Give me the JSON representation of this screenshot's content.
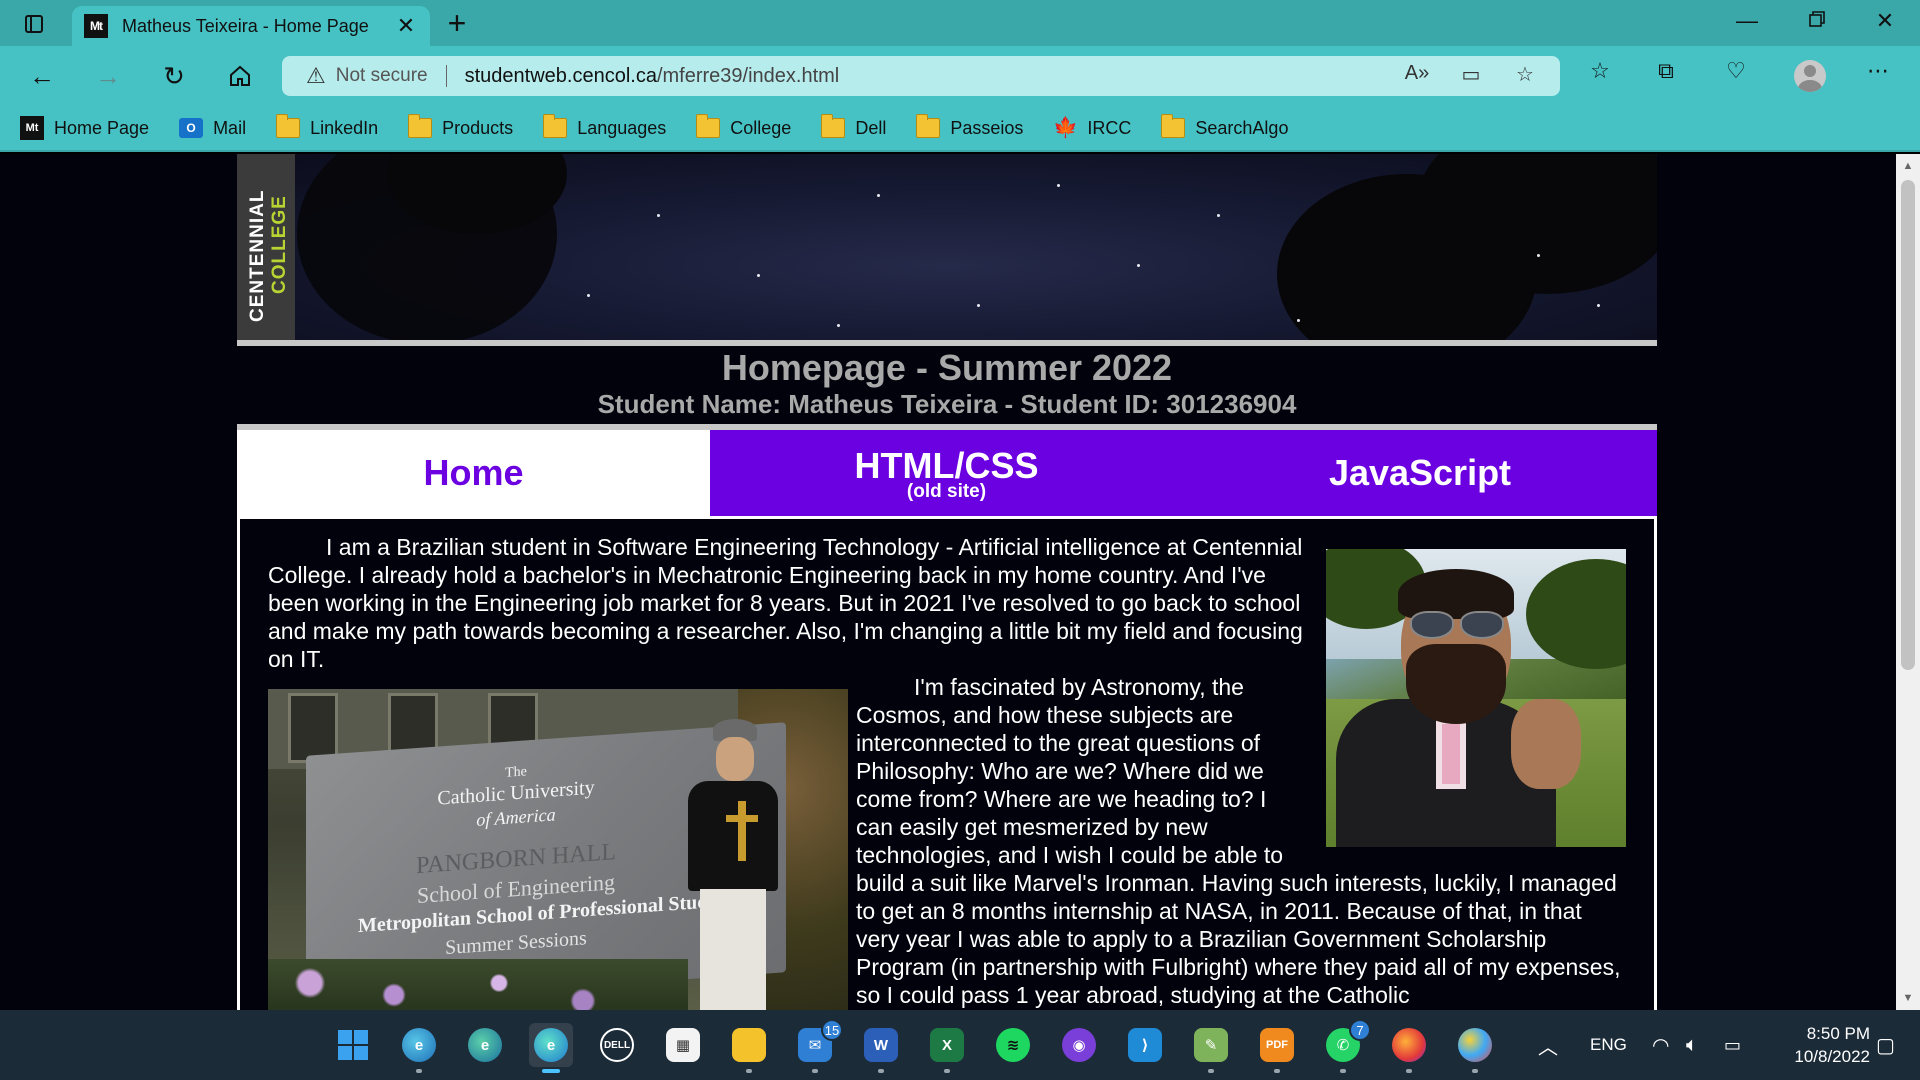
{
  "browser": {
    "tab_title": "Matheus Teixeira - Home Page",
    "tab_favicon": "Mt",
    "address": {
      "security": "Not secure",
      "domain": "studentweb.cencol.ca",
      "path": "/mferre39/index.html"
    },
    "bookmarks": [
      {
        "label": "Home Page",
        "icon": "mt-favicon-icon"
      },
      {
        "label": "Mail",
        "icon": "outlook-icon"
      },
      {
        "label": "LinkedIn",
        "icon": "folder-icon"
      },
      {
        "label": "Products",
        "icon": "folder-icon"
      },
      {
        "label": "Languages",
        "icon": "folder-icon"
      },
      {
        "label": "College",
        "icon": "folder-icon"
      },
      {
        "label": "Dell",
        "icon": "folder-icon"
      },
      {
        "label": "Passeios",
        "icon": "folder-icon"
      },
      {
        "label": "IRCC",
        "icon": "maple-leaf-icon"
      },
      {
        "label": "SearchAlgo",
        "icon": "folder-icon"
      }
    ]
  },
  "page": {
    "logo_line1": "CENTENNIAL",
    "logo_line2": "COLLEGE",
    "title": "Homepage - Summer 2022",
    "subtitle": "Student Name: Matheus Teixeira - Student ID: 301236904",
    "menu": {
      "home": "Home",
      "html_css": "HTML/CSS",
      "html_css_sub": "(old site)",
      "javascript": "JavaScript"
    },
    "paragraph1": "I am a Brazilian student in Software Engineering Technology - Artificial intelligence at Centennial College. I already hold a bachelor's in Mechatronic Engineering back in my home country. And I've been working in the Engineering job market for 8 years. But in 2021 I've resolved to go back to school and make my path towards becoming a researcher. Also, I'm changing a little bit my field and focusing on IT.",
    "paragraph2": "I'm fascinated by Astronomy, the Cosmos, and how these subjects are interconnected to the great questions of Philosophy: Who are we? Where did we come from? Where are we heading to? I can easily get mesmerized by new technologies, and I wish I could be able to build a suit like Marvel's Ironman. Having such interests, luckily, I managed to get an 8 months internship at NASA, in 2011. Because of that, in that very year I was able to apply to a Brazilian Government Scholarship Program (in partnership with Fulbright) where they paid all of my expenses, so I could pass 1 year abroad, studying at the Catholic",
    "sign": {
      "line1": "The",
      "line2": "Catholic University",
      "line3": "of America",
      "line4": "PANGBORN HALL",
      "line5": "School of Engineering",
      "line6": "Metropolitan School of Professional Studi",
      "line7": "Summer Sessions"
    }
  },
  "taskbar": {
    "apps": [
      {
        "name": "start-button",
        "badge": ""
      },
      {
        "name": "edge-beta-icon",
        "badge": ""
      },
      {
        "name": "edge-dev-icon",
        "badge": ""
      },
      {
        "name": "edge-icon",
        "badge": ""
      },
      {
        "name": "dell-icon",
        "badge": ""
      },
      {
        "name": "store-icon",
        "badge": ""
      },
      {
        "name": "file-explorer-icon",
        "badge": ""
      },
      {
        "name": "mail-icon",
        "badge": "15"
      },
      {
        "name": "word-icon",
        "badge": ""
      },
      {
        "name": "excel-icon",
        "badge": ""
      },
      {
        "name": "spotify-icon",
        "badge": ""
      },
      {
        "name": "github-icon",
        "badge": ""
      },
      {
        "name": "vscode-icon",
        "badge": ""
      },
      {
        "name": "notepad-icon",
        "badge": ""
      },
      {
        "name": "pdf-icon",
        "badge": ""
      },
      {
        "name": "whatsapp-icon",
        "badge": "7"
      },
      {
        "name": "firefox-icon",
        "badge": ""
      },
      {
        "name": "paint-icon",
        "badge": ""
      }
    ],
    "language": "ENG",
    "time": "8:50 PM",
    "date": "10/8/2022"
  },
  "colors": {
    "chrome": "#46c2c4",
    "menu_purple": "#6b00e0",
    "page_bg": "#02020c"
  }
}
